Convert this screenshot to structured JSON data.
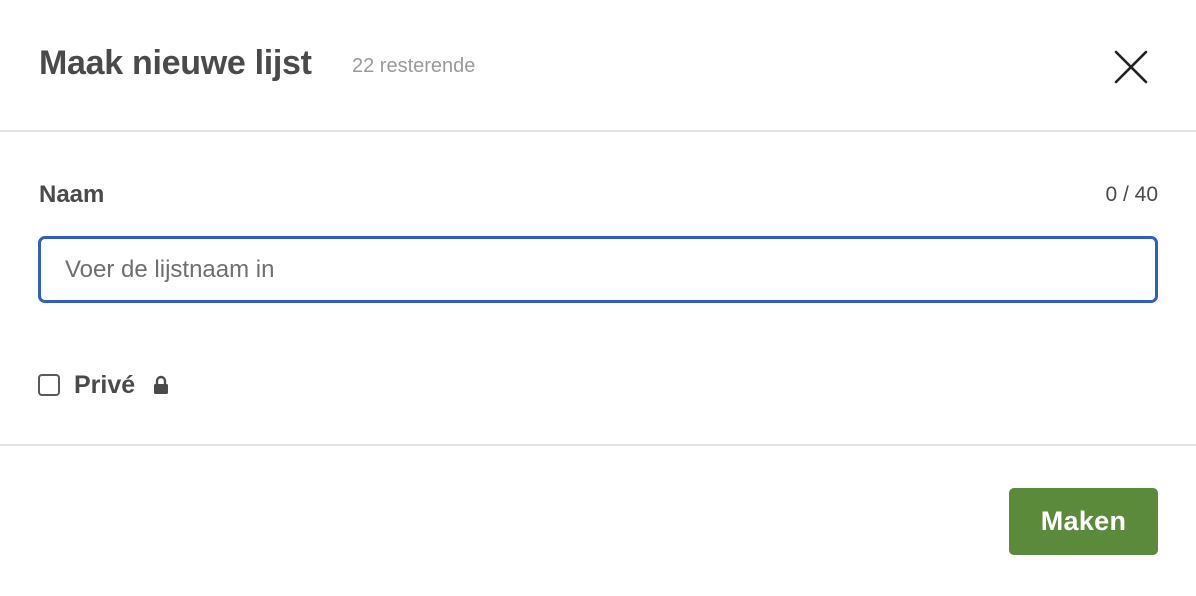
{
  "dialog": {
    "title": "Maak nieuwe lijst",
    "remaining": "22 resterende",
    "close_icon": "close-icon"
  },
  "form": {
    "name_label": "Naam",
    "char_count": "0 / 40",
    "name_value": "",
    "name_placeholder": "Voer de lijstnaam in",
    "private_label": "Privé",
    "private_checked": false,
    "private_icon": "lock-icon"
  },
  "footer": {
    "create_label": "Maken"
  },
  "colors": {
    "accent_button": "#5b8a3a",
    "input_focus_border": "#2f5fbf",
    "text": "#4a4a4a",
    "muted_text": "#9a9a9a"
  }
}
